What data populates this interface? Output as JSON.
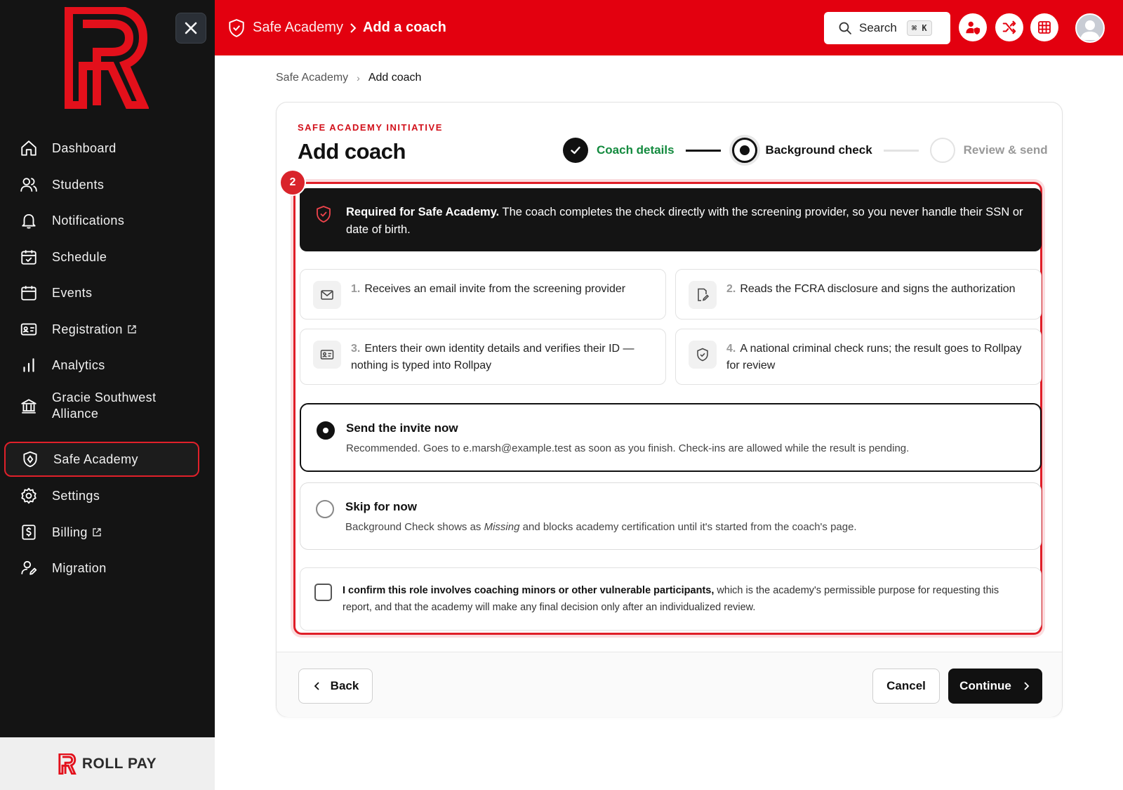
{
  "app": {
    "brand": "ROLL PAY"
  },
  "sidebar": {
    "items": [
      {
        "label": "Dashboard",
        "icon": "home-icon"
      },
      {
        "label": "Students",
        "icon": "users-icon"
      },
      {
        "label": "Notifications",
        "icon": "bell-icon"
      },
      {
        "label": "Schedule",
        "icon": "calendar-check-icon"
      },
      {
        "label": "Events",
        "icon": "calendar-icon"
      },
      {
        "label": "Registration",
        "icon": "id-card-icon",
        "external": true
      },
      {
        "label": "Analytics",
        "icon": "bar-chart-icon"
      },
      {
        "label": "Gracie Southwest Alliance",
        "icon": "bank-icon"
      },
      {
        "label": "Safe Academy",
        "icon": "shield-icon",
        "active": true
      },
      {
        "label": "Settings",
        "icon": "gear-icon"
      },
      {
        "label": "Billing",
        "icon": "dollar-icon",
        "external": true
      },
      {
        "label": "Migration",
        "icon": "user-edit-icon"
      }
    ]
  },
  "topbar": {
    "crumb_parent": "Safe Academy",
    "crumb_current": "Add a coach",
    "search_label": "Search",
    "search_shortcut": "⌘ K",
    "accent_color": "#e3000f"
  },
  "breadcrumb": {
    "parent": "Safe Academy",
    "current": "Add coach"
  },
  "card": {
    "eyebrow": "SAFE ACADEMY INITIATIVE",
    "title": "Add coach",
    "badge": "2",
    "steps": [
      {
        "label": "Coach details",
        "state": "complete"
      },
      {
        "label": "Background check",
        "state": "current"
      },
      {
        "label": "Review & send",
        "state": "upcoming"
      }
    ],
    "notice": {
      "bold": "Required for Safe Academy.",
      "text": " The coach completes the check directly with the screening provider, so you never handle their SSN or date of birth."
    },
    "process": [
      {
        "num": "1.",
        "text": "Receives an email invite from the screening provider",
        "icon": "mail-icon"
      },
      {
        "num": "2.",
        "text": "Reads the FCRA disclosure and signs the authorization",
        "icon": "sign-document-icon"
      },
      {
        "num": "3.",
        "text": "Enters their own identity details and verifies their ID — nothing is typed into Rollpay",
        "icon": "id-card-icon"
      },
      {
        "num": "4.",
        "text": "A national criminal check runs; the result goes to Rollpay for review",
        "icon": "shield-check-icon"
      }
    ],
    "options": [
      {
        "title": "Send the invite now",
        "desc": "Recommended. Goes to e.marsh@example.test as soon as you finish. Check-ins are allowed while the result is pending.",
        "selected": true
      },
      {
        "title": "Skip for now",
        "desc_pre": "Background Check shows as ",
        "desc_em": "Missing",
        "desc_post": " and blocks academy certification until it's started from the coach's page.",
        "selected": false
      }
    ],
    "confirm": {
      "bold": "I confirm this role involves coaching minors or other vulnerable participants,",
      "text": " which is the academy's permissible purpose for requesting this report, and that the academy will make any final decision only after an individualized review.",
      "checked": false
    },
    "buttons": {
      "back": "Back",
      "cancel": "Cancel",
      "continue": "Continue"
    }
  }
}
